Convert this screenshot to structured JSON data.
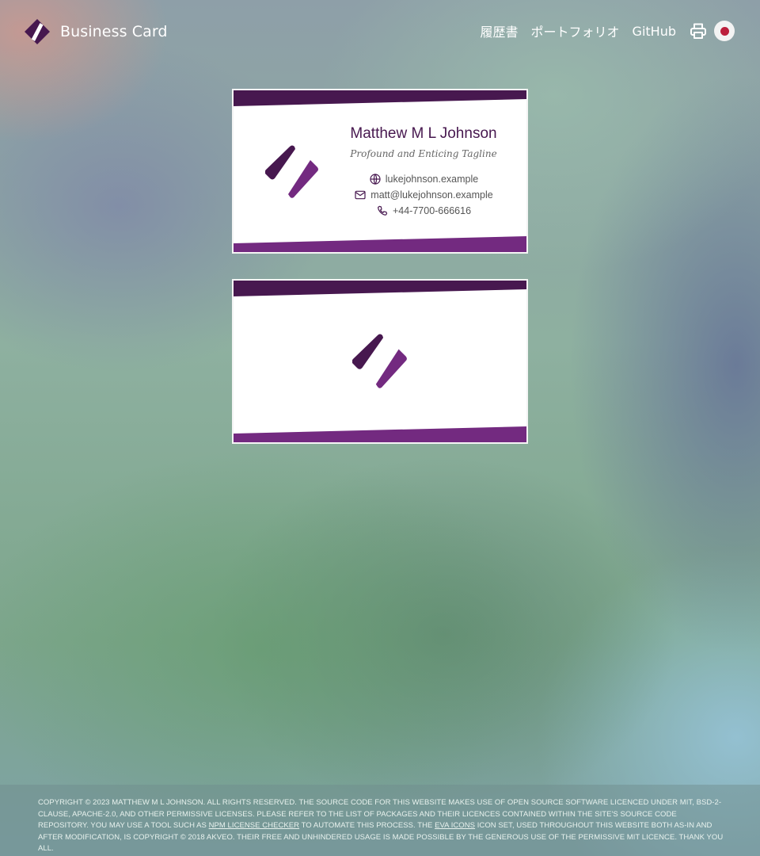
{
  "header": {
    "brand_title": "Business Card",
    "nav": {
      "resume": "履歴書",
      "portfolio": "ポートフォリオ",
      "github": "GitHub"
    },
    "print_icon": "printer-icon",
    "language_icon": "japan-flag-icon"
  },
  "colors": {
    "brand_dark": "#47184f",
    "brand_light": "#732a80",
    "flag_red": "#bc1f3c"
  },
  "card_front": {
    "name": "Matthew M L Johnson",
    "tagline": "Profound and Enticing Tagline",
    "website": "lukejohnson.example",
    "email": "matt@lukejohnson.example",
    "phone": "+44-7700-666616"
  },
  "footer": {
    "text_1": "Copyright © 2023 Matthew M L Johnson. All rights reserved. The source code for this website makes use of open source software licenced under MIT, BSD-2-Clause, Apache-2.0, and other permissive licenses. Please refer to the list of packages and their licences contained within the site's source code repository. You may use a tool such as ",
    "link_1": "npm license checker",
    "text_2": " to automate this process. The ",
    "link_2": "Eva Icons",
    "text_3": " icon set, used throughout this website both as-in and after modification, is copyright © 2018 Akveo. Their free and unhindered usage is made possible by the generous use of the permissive MIT licence. Thank you all."
  }
}
